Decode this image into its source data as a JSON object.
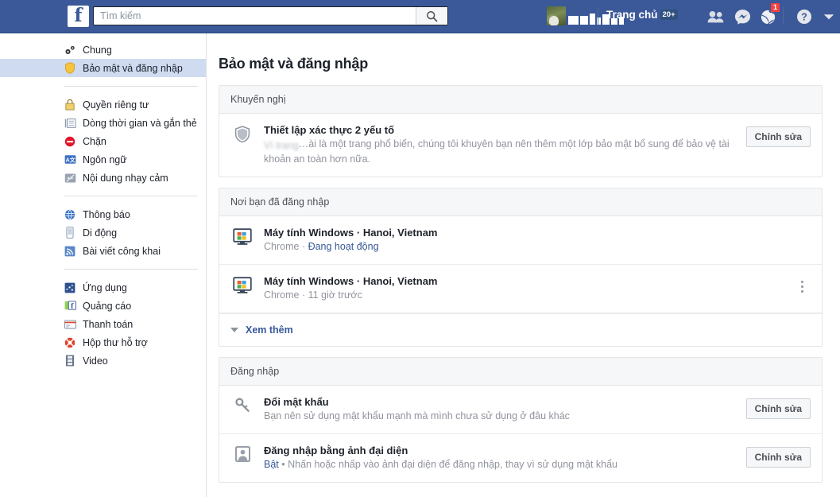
{
  "topbar": {
    "logo_letter": "f",
    "search": {
      "placeholder": "Tìm kiếm",
      "value": ""
    },
    "profile_name_redacted": "",
    "home_label": "Trang chủ",
    "home_badge": "20+",
    "notifications_badge": "1",
    "icons": {
      "friends": "friend-requests-icon",
      "messenger": "messenger-icon",
      "notifications": "notifications-globe-icon",
      "help": "help-icon",
      "account": "account-dropdown-icon"
    },
    "accent": "#3b5998"
  },
  "sidebar": {
    "groups": [
      {
        "items": [
          {
            "label": "Chung",
            "icon": "gears-icon",
            "active": false
          },
          {
            "label": "Bảo mật và đăng nhập",
            "icon": "shield-icon",
            "active": true
          }
        ]
      },
      {
        "items": [
          {
            "label": "Quyền riêng tư",
            "icon": "lock-icon",
            "active": false
          },
          {
            "label": "Dòng thời gian và gắn thẻ",
            "icon": "timeline-icon",
            "active": false
          },
          {
            "label": "Chặn",
            "icon": "block-icon",
            "active": false
          },
          {
            "label": "Ngôn ngữ",
            "icon": "language-icon",
            "active": false
          },
          {
            "label": "Nội dung nhạy cảm",
            "icon": "eye-off-icon",
            "active": false
          }
        ]
      },
      {
        "items": [
          {
            "label": "Thông báo",
            "icon": "globe-icon",
            "active": false
          },
          {
            "label": "Di động",
            "icon": "mobile-icon",
            "active": false
          },
          {
            "label": "Bài viết công khai",
            "icon": "rss-icon",
            "active": false
          }
        ]
      },
      {
        "items": [
          {
            "label": "Ứng dụng",
            "icon": "apps-icon",
            "active": false
          },
          {
            "label": "Quảng cáo",
            "icon": "ads-icon",
            "active": false
          },
          {
            "label": "Thanh toán",
            "icon": "payments-icon",
            "active": false
          },
          {
            "label": "Hộp thư hỗ trợ",
            "icon": "support-lifering-icon",
            "active": false
          },
          {
            "label": "Video",
            "icon": "video-film-icon",
            "active": false
          }
        ]
      }
    ]
  },
  "main": {
    "page_title": "Bảo mật và đăng nhập",
    "recommended": {
      "header": "Khuyến nghị",
      "row": {
        "icon": "shield-icon",
        "title": "Thiết lập xác thực 2 yếu tố",
        "desc_blurred": "Vì trang",
        "desc": "…ài là một trang phổ biến, chúng tôi khuyên bạn nên thêm một lớp bảo mật bổ sung để bảo vệ tài khoản an toàn hơn nữa.",
        "button": "Chỉnh sửa"
      }
    },
    "sessions": {
      "header": "Nơi bạn đã đăng nhập",
      "items": [
        {
          "icon": "windows-computer-icon",
          "title": "Máy tính Windows · Hanoi, Vietnam",
          "browser": "Chrome",
          "separator": " · ",
          "status": "Đang hoạt động",
          "status_is_link": true,
          "has_menu": false
        },
        {
          "icon": "windows-computer-icon",
          "title": "Máy tính Windows · Hanoi, Vietnam",
          "browser": "Chrome",
          "separator": " · ",
          "status": "11 giờ trước",
          "status_is_link": false,
          "has_menu": true
        }
      ],
      "see_more": "Xem thêm"
    },
    "login": {
      "header": "Đăng nhập",
      "items": [
        {
          "icon": "key-icon",
          "title": "Đổi mật khẩu",
          "state": "",
          "desc": "Bạn nên sử dụng mật khẩu mạnh mà mình chưa sử dụng ở đâu khác",
          "button": "Chỉnh sửa"
        },
        {
          "icon": "profile-picture-icon",
          "title": "Đăng nhập bằng ảnh đại diện",
          "state": "Bật",
          "desc": " • Nhấn hoặc nhấp vào ảnh đại diện để đăng nhập, thay vì sử dụng mật khẩu",
          "button": "Chỉnh sửa"
        }
      ]
    }
  }
}
